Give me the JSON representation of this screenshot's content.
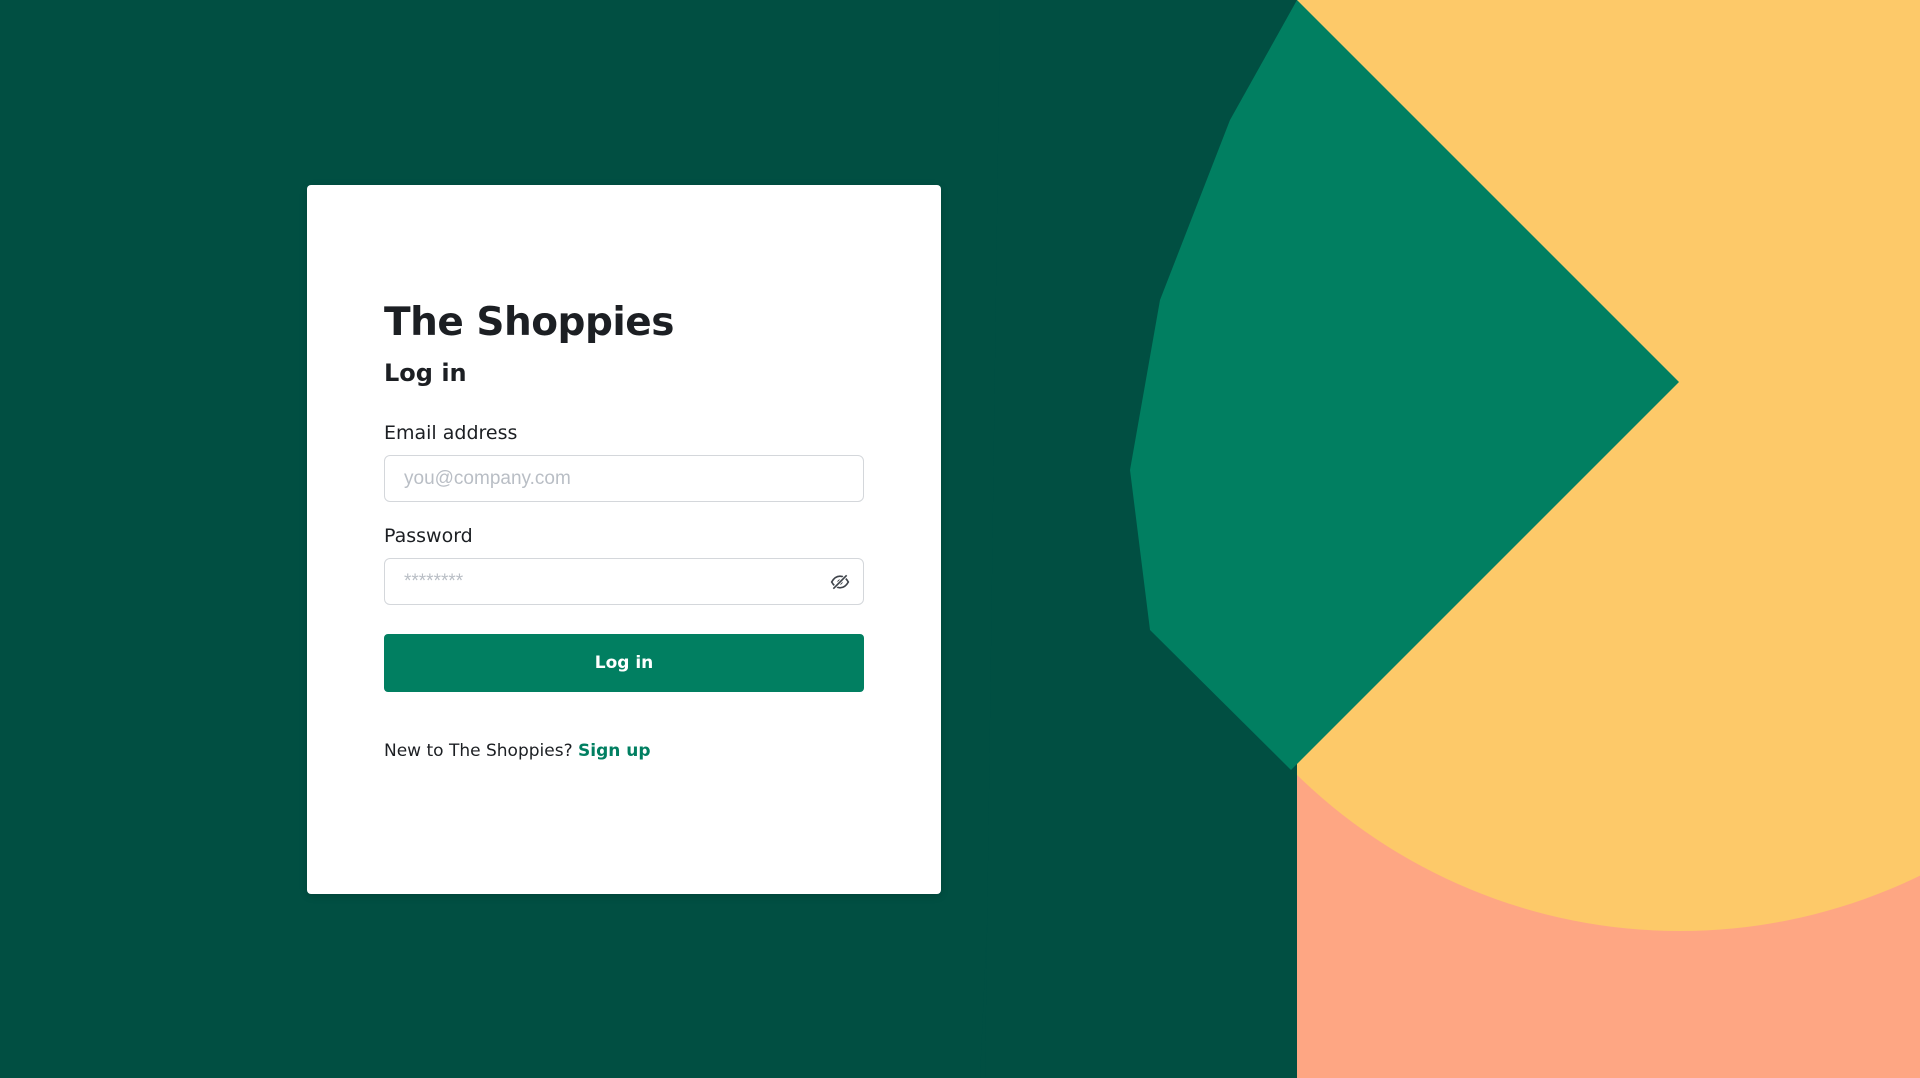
{
  "page": {
    "brand_name": "The Shoppies",
    "subtitle": "Log in"
  },
  "form": {
    "email": {
      "label": "Email address",
      "placeholder": "you@company.com",
      "value": ""
    },
    "password": {
      "label": "Password",
      "placeholder": "********",
      "value": "",
      "toggle_icon": "eye-slash-icon"
    },
    "submit_label": "Log in"
  },
  "signup": {
    "prompt": "New to The Shoppies?",
    "link_label": "Sign up"
  },
  "colors": {
    "background": "#014f42",
    "brand_green": "#017f61",
    "yellow": "#fdc969",
    "salmon": "#fea683",
    "card": "#ffffff"
  }
}
